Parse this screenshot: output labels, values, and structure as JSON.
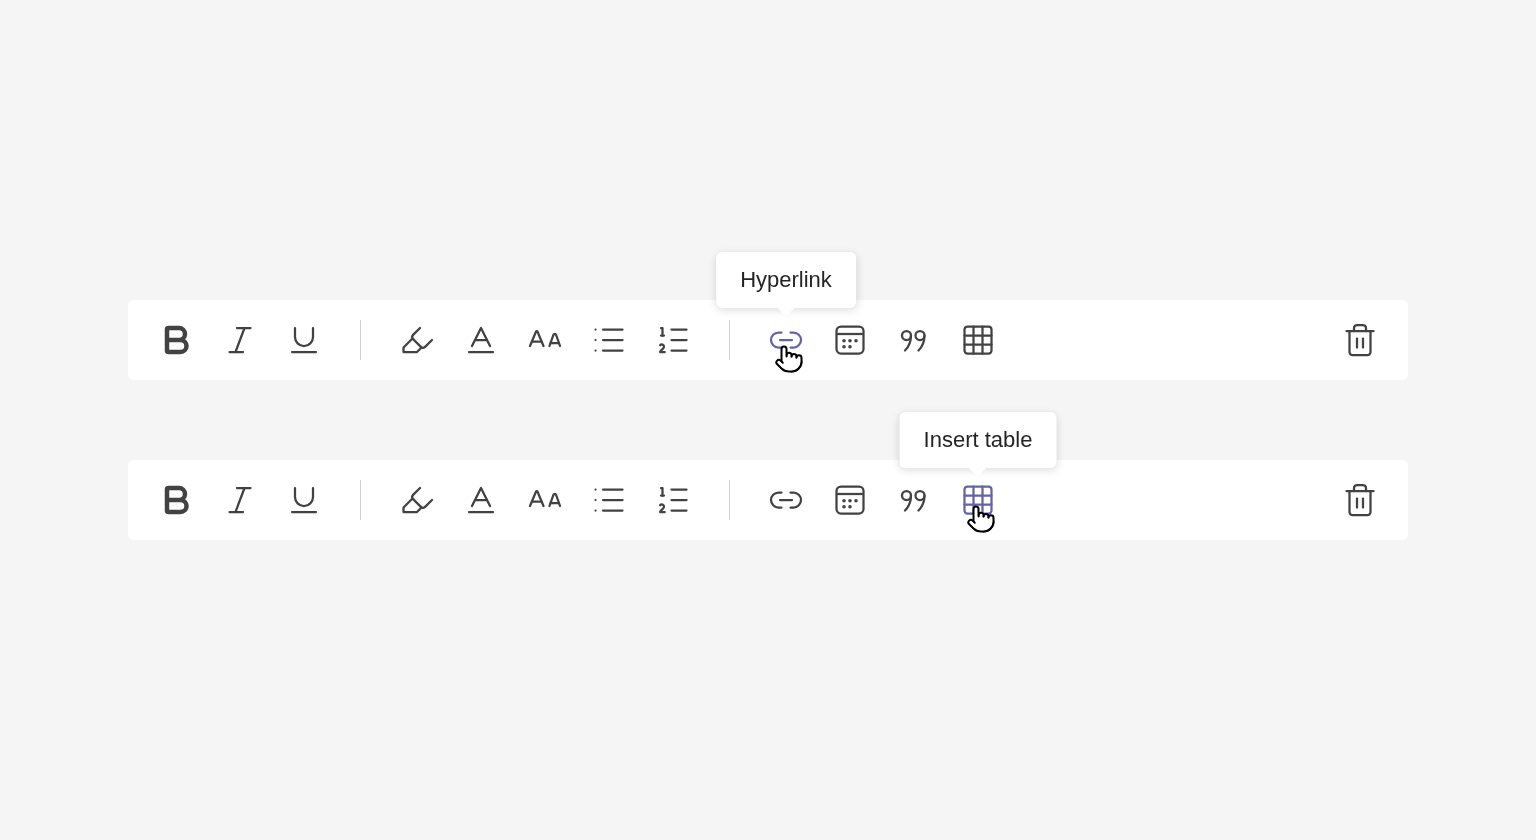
{
  "toolbars": [
    {
      "tooltip": "Hyperlink",
      "items": [
        {
          "kind": "bold",
          "hovered": false
        },
        {
          "kind": "italic",
          "hovered": false
        },
        {
          "kind": "underline",
          "hovered": false
        },
        {
          "kind": "divider"
        },
        {
          "kind": "highlight",
          "hovered": false
        },
        {
          "kind": "font-color",
          "hovered": false
        },
        {
          "kind": "font-size",
          "hovered": false
        },
        {
          "kind": "bullets",
          "hovered": false
        },
        {
          "kind": "numbering",
          "hovered": false
        },
        {
          "kind": "divider"
        },
        {
          "kind": "link",
          "hovered": true
        },
        {
          "kind": "calendar",
          "hovered": false
        },
        {
          "kind": "quote",
          "hovered": false
        },
        {
          "kind": "table",
          "hovered": false
        },
        {
          "kind": "spacer"
        },
        {
          "kind": "delete",
          "hovered": false
        }
      ]
    },
    {
      "tooltip": "Insert table",
      "items": [
        {
          "kind": "bold",
          "hovered": false
        },
        {
          "kind": "italic",
          "hovered": false
        },
        {
          "kind": "underline",
          "hovered": false
        },
        {
          "kind": "divider"
        },
        {
          "kind": "highlight",
          "hovered": false
        },
        {
          "kind": "font-color",
          "hovered": false
        },
        {
          "kind": "font-size",
          "hovered": false
        },
        {
          "kind": "bullets",
          "hovered": false
        },
        {
          "kind": "numbering",
          "hovered": false
        },
        {
          "kind": "divider"
        },
        {
          "kind": "link",
          "hovered": false
        },
        {
          "kind": "calendar",
          "hovered": false
        },
        {
          "kind": "quote",
          "hovered": false
        },
        {
          "kind": "table",
          "hovered": true
        },
        {
          "kind": "spacer"
        },
        {
          "kind": "delete",
          "hovered": false
        }
      ]
    }
  ]
}
